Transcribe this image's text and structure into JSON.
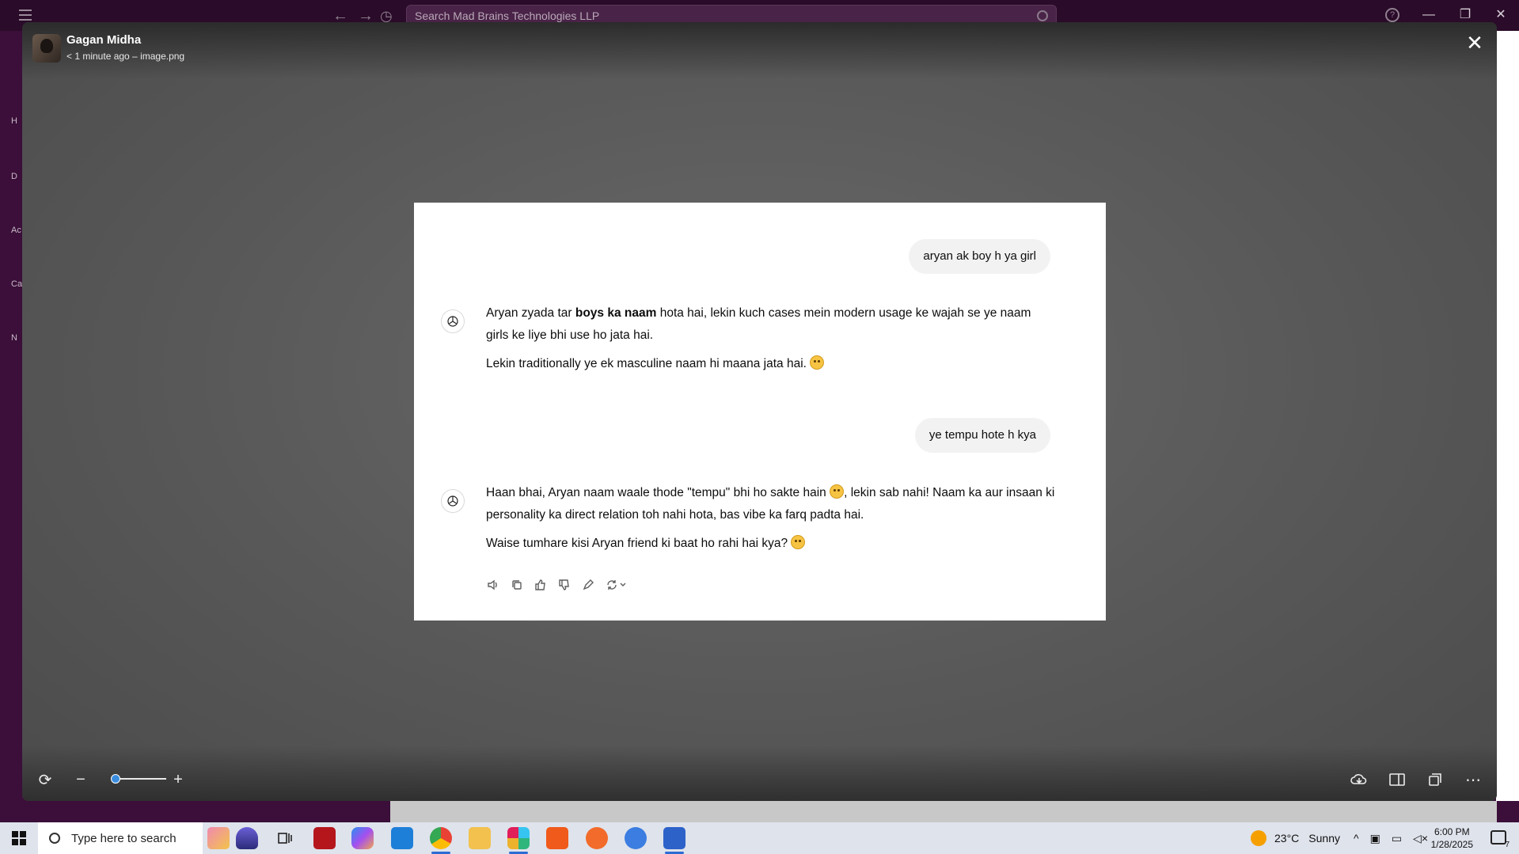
{
  "titlebar": {
    "search_placeholder": "Search Mad Brains Technologies LLP",
    "help_label": "?",
    "back_icon": "arrow-left-icon",
    "forward_icon": "arrow-right-icon",
    "history_icon": "clock-icon"
  },
  "sidebar": {
    "letters": [
      "H",
      "D",
      "Ac",
      "Ca",
      "N"
    ]
  },
  "viewer": {
    "author": "Gagan Midha",
    "meta": "< 1 minute ago – image.png",
    "close_label": "✕"
  },
  "chat": {
    "user_message_1": "aryan ak boy h ya girl",
    "assistant_1": {
      "line1_before_bold": "Aryan zyada tar ",
      "line1_bold": "boys ka naam",
      "line1_after_bold": " hota hai, lekin kuch cases mein modern usage ke wajah se ye naam girls ke liye bhi use ho jata hai.",
      "line2": "Lekin traditionally ye ek masculine naam hi maana jata hai."
    },
    "user_message_2": "ye tempu hote h kya",
    "assistant_2": {
      "line1_before_emoji": "Haan bhai, Aryan naam waale thode \"tempu\" bhi ho sakte hain",
      "line1_after_emoji": ", lekin sab nahi! Naam ka aur insaan ki personality ka direct relation toh nahi hota, bas vibe ka farq padta hai.",
      "line2": "Waise tumhare kisi Aryan friend ki baat ho rahi hai kya?"
    },
    "action_icons": [
      "speaker-icon",
      "copy-icon",
      "thumbs-up-icon",
      "thumbs-down-icon",
      "edit-icon",
      "regenerate-icon"
    ]
  },
  "taskbar": {
    "search_placeholder": "Type here to search",
    "weather_temp": "23°C",
    "weather_desc": "Sunny",
    "time": "6:00 PM",
    "date": "1/28/2025",
    "notification_count": "7"
  }
}
